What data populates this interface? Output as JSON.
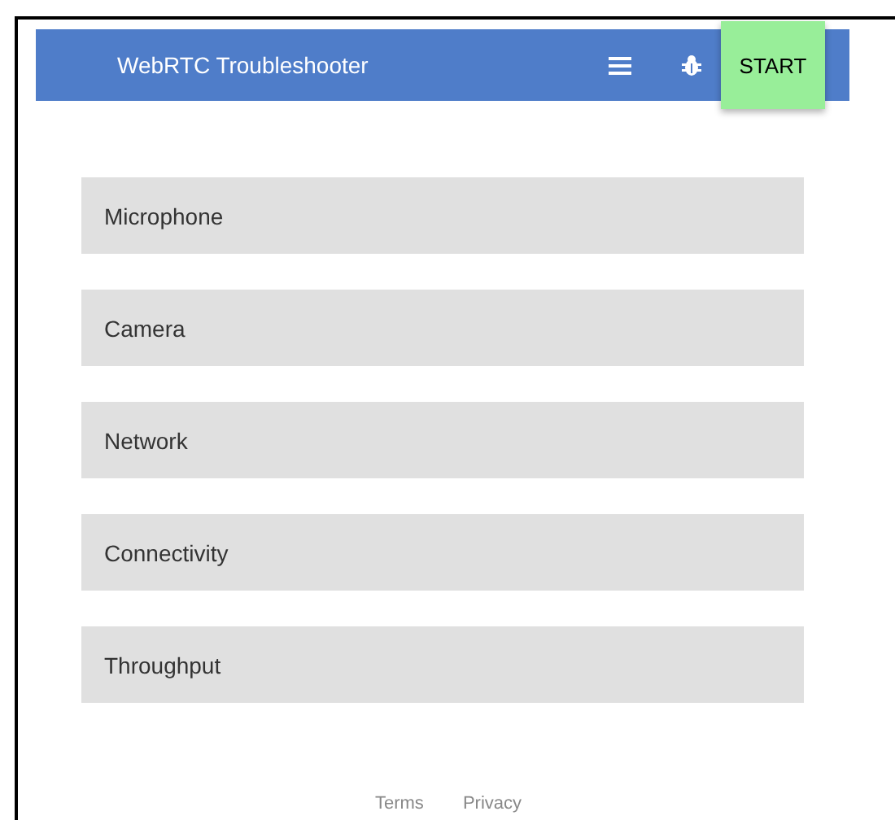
{
  "header": {
    "title": "WebRTC Troubleshooter",
    "start_button": "START"
  },
  "sections": [
    {
      "label": "Microphone"
    },
    {
      "label": "Camera"
    },
    {
      "label": "Network"
    },
    {
      "label": "Connectivity"
    },
    {
      "label": "Throughput"
    }
  ],
  "footer": {
    "links": [
      "Terms",
      "Privacy"
    ]
  }
}
